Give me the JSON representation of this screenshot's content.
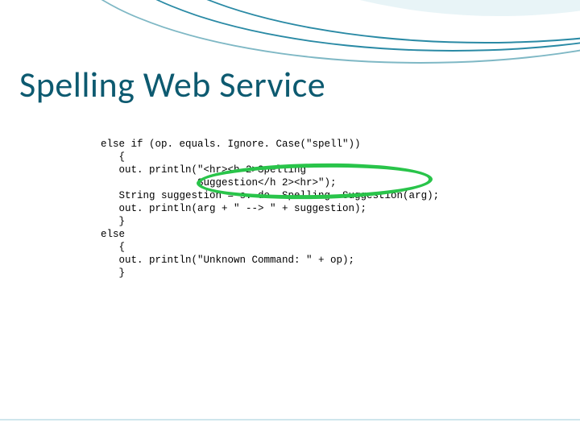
{
  "title": "Spelling Web Service",
  "code": {
    "l1": "else if (op. equals. Ignore. Case(\"spell\"))",
    "l2": "   {",
    "l3": "   out. println(\"<hr><h 2>Spelling",
    "l4": "                Suggestion</h 2><hr>\");",
    "l5": "   String suggestion = s. do. Spelling. Suggestion(arg);",
    "l6": "   out. println(arg + \" --> \" + suggestion);",
    "l7": "   }",
    "l8": "else",
    "l9": "   {",
    "l10": "   out. println(\"Unknown Command: \" + op);",
    "l11": "   }"
  }
}
